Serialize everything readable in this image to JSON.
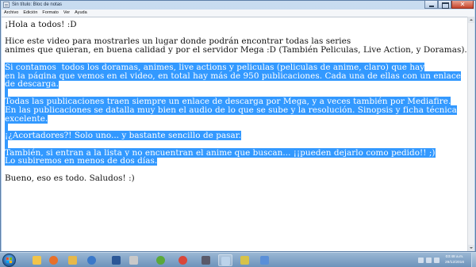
{
  "window": {
    "title": "Sin título: Bloc de notas"
  },
  "menu": [
    "Archivo",
    "Edición",
    "Formato",
    "Ver",
    "Ayuda"
  ],
  "document": {
    "lines": [
      {
        "text": "¡Hola a todos! :D",
        "selected": false
      },
      {
        "text": "",
        "selected": false
      },
      {
        "text": "Hice este video para mostrarles un lugar donde podrán encontrar todas las series",
        "selected": false
      },
      {
        "text": "animes que quieran, en buena calidad y por el servidor Mega :D (También Peliculas, Live Action, y Doramas).",
        "selected": false
      },
      {
        "text": "",
        "selected": false
      },
      {
        "text": "Si contamos  todos los doramas, animes, live actions y peliculas (peliculas de anime, claro) que hay",
        "selected": true
      },
      {
        "text": "en la página que vemos en el video, en total hay más de 950 publicaciones. Cada una de ellas con un enlace",
        "selected": true
      },
      {
        "text": "de descarga.",
        "selected": true
      },
      {
        "text": "",
        "selected": true
      },
      {
        "text": "Todas las publicaciones traen siempre un enlace de descarga por Mega, y a veces también por Mediafire.",
        "selected": true
      },
      {
        "text": "En las publicaciones se datalla muy bien el audio de lo que se sube y la resolución. Sinopsis y ficha técnica",
        "selected": true
      },
      {
        "text": "excelente.",
        "selected": true
      },
      {
        "text": "",
        "selected": true
      },
      {
        "text": "¡¿Acortadores?! Solo uno... y bastante sencillo de pasar.",
        "selected": true
      },
      {
        "text": "",
        "selected": true
      },
      {
        "text": "También, si entran a la lista y no encuentran el anime que buscan... ¡¡pueden dejarlo como pedido!! ;)",
        "selected": true
      },
      {
        "text": "Lo subiremos en menos de dos días.",
        "selected": true
      },
      {
        "text": "",
        "selected": false
      },
      {
        "text": "Bueno, eso es todo. Saludos! :)",
        "selected": false
      }
    ]
  },
  "taskbar": {
    "apps": [
      {
        "name": "explorer-icon",
        "color": "#f1c44a"
      },
      {
        "name": "firefox-icon",
        "color": "#e8702a"
      },
      {
        "name": "folder-icon",
        "color": "#e6b84a"
      },
      {
        "name": "media-player-icon",
        "color": "#3a78c9"
      },
      {
        "name": "word-icon",
        "color": "#2b5797"
      },
      {
        "name": "app-icon",
        "color": "#c9c9c9"
      },
      {
        "name": "utorrent-icon",
        "color": "#5aa83a"
      },
      {
        "name": "chrome-icon",
        "color": "#d9473a"
      },
      {
        "name": "media-icon",
        "color": "#5a5a6a"
      },
      {
        "name": "notepad-icon",
        "color": "#bcd3ea"
      },
      {
        "name": "sticky-icon",
        "color": "#d6c24a"
      },
      {
        "name": "app2-icon",
        "color": "#5a8fd8"
      }
    ],
    "clock_time": "03:48 a.m.",
    "clock_date": "29/12/2016"
  }
}
